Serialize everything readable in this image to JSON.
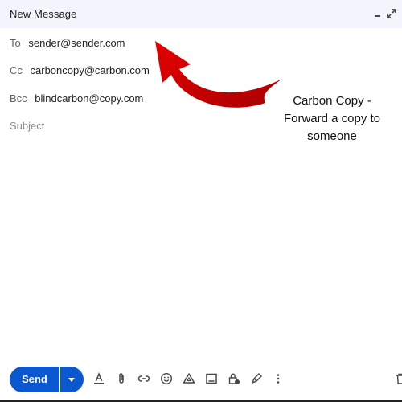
{
  "window": {
    "title": "New Message",
    "minimize_icon": "minimize-icon",
    "expand_icon": "expand-icon"
  },
  "fields": {
    "to": {
      "label": "To",
      "value": "sender@sender.com"
    },
    "cc": {
      "label": "Cc",
      "value": "carboncopy@carbon.com"
    },
    "bcc": {
      "label": "Bcc",
      "value": "blindcarbon@copy.com"
    },
    "subject": {
      "placeholder": "Subject"
    }
  },
  "annotation": {
    "text_line1": "Carbon Copy -",
    "text_line2": "Forward a copy to",
    "text_line3": "someone",
    "arrow_color": "#d40000"
  },
  "toolbar": {
    "send_label": "Send",
    "send_color": "#0b57d0",
    "tools": [
      {
        "name": "formatting-options",
        "icon": "text-format-icon"
      },
      {
        "name": "attach-files",
        "icon": "paperclip-icon"
      },
      {
        "name": "insert-link",
        "icon": "link-icon"
      },
      {
        "name": "insert-emoji",
        "icon": "emoji-icon"
      },
      {
        "name": "insert-drive",
        "icon": "drive-icon"
      },
      {
        "name": "insert-photo",
        "icon": "image-icon"
      },
      {
        "name": "confidential-mode",
        "icon": "lock-clock-icon"
      },
      {
        "name": "insert-signature",
        "icon": "pen-icon"
      },
      {
        "name": "more-options",
        "icon": "more-vert-icon"
      },
      {
        "name": "discard-draft",
        "icon": "trash-icon"
      }
    ]
  }
}
